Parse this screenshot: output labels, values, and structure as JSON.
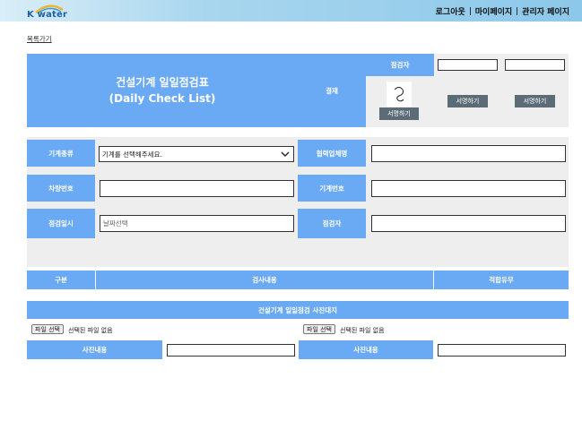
{
  "header": {
    "logo_text": "K water",
    "nav": {
      "logout": "로그아웃",
      "mypage": "마이페이지",
      "admin": "관리자 페이지"
    }
  },
  "back_link": "목록가기",
  "title": {
    "korean": "건설기계 일일점검표",
    "english": "(Daily Check List)"
  },
  "approval": {
    "label": "결재",
    "inspector_label": "점검자",
    "sign_buttons": [
      "서명하기",
      "서명하기",
      "서명하기"
    ]
  },
  "form": {
    "machine_type_label": "기계종류",
    "machine_type_value": "기계를 선택해주세요.",
    "partner_label": "협력업체명",
    "vehicle_no_label": "차량번호",
    "machine_no_label": "기계번호",
    "inspection_date_label": "점검일시",
    "inspection_date_placeholder": "날짜선택",
    "inspector_label": "점검자"
  },
  "table": {
    "headers": [
      "구분",
      "검사내용",
      "적합유무"
    ]
  },
  "photo": {
    "section_title": "건설기계 일일점검 사진대지",
    "file_button": "파일 선택",
    "no_file": "선택된 파일 없음",
    "content_label": "사진내용"
  },
  "colors": {
    "accent_blue": "#6aa9f4",
    "button_gray": "#5c6c77",
    "section_gray": "#eeeeee"
  }
}
